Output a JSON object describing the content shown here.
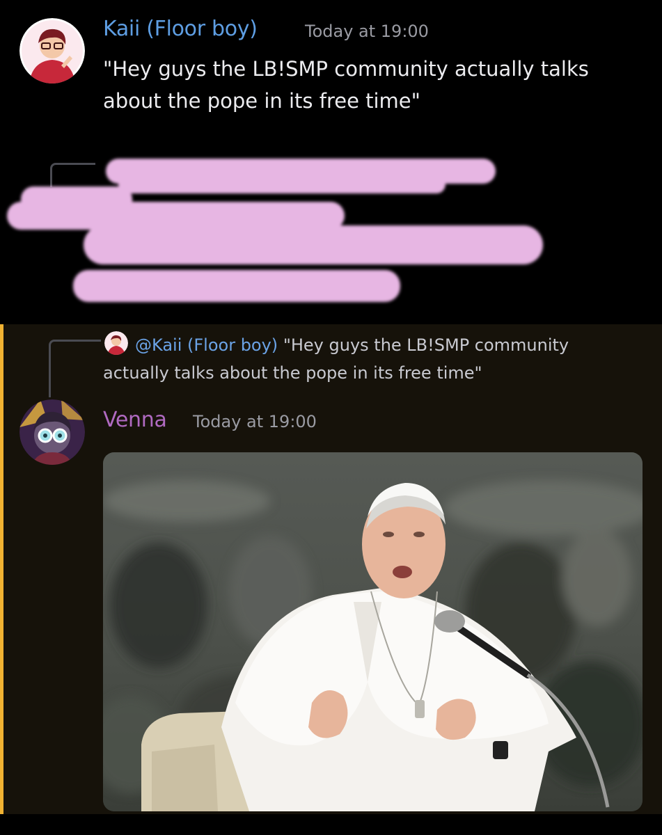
{
  "message_1": {
    "username": "Kaii (Floor boy)",
    "timestamp": "Today at 19:00",
    "text": "\"Hey guys the LB!SMP community actually talks about the pope in its free time\"",
    "username_color": "#5e9ee3"
  },
  "redacted_block": {
    "highlight_color": "#e7b6e3"
  },
  "message_2": {
    "reply": {
      "mention": "@Kaii (Floor boy)",
      "text": "\"Hey guys the LB!SMP community actually talks about the pope in its free time\""
    },
    "username": "Venna",
    "timestamp": "Today at 19:00",
    "username_color": "#b06ac1",
    "highlight_bar_color": "#f0b232",
    "attachment_icon": "photo-attachment"
  }
}
